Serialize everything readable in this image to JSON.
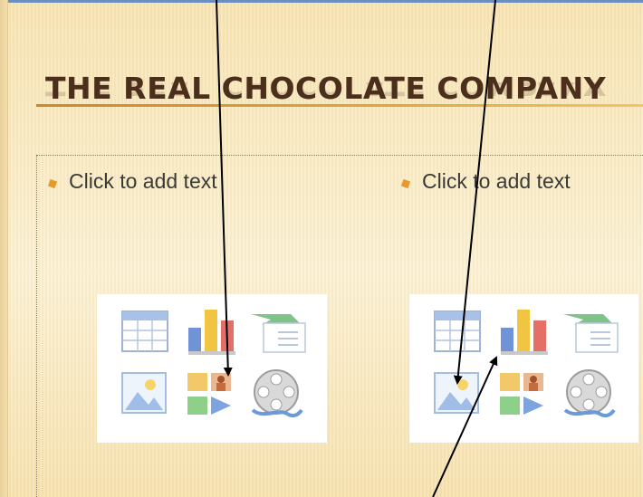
{
  "slide": {
    "title": "THE REAL CHOCOLATE COMPANY",
    "left_placeholder": {
      "text": "Click to add text"
    },
    "right_placeholder": {
      "text": "Click to add text"
    }
  },
  "content_icons": [
    "table-icon",
    "chart-icon",
    "smartart-icon",
    "picture-icon",
    "clip-art-icon",
    "media-clip-icon"
  ],
  "colors": {
    "title": "#4b2f1c",
    "title_underline": "#d9992f",
    "bullet_mark": "#e69a2e",
    "background": "#f9ebc6",
    "arrow": "#000000"
  }
}
